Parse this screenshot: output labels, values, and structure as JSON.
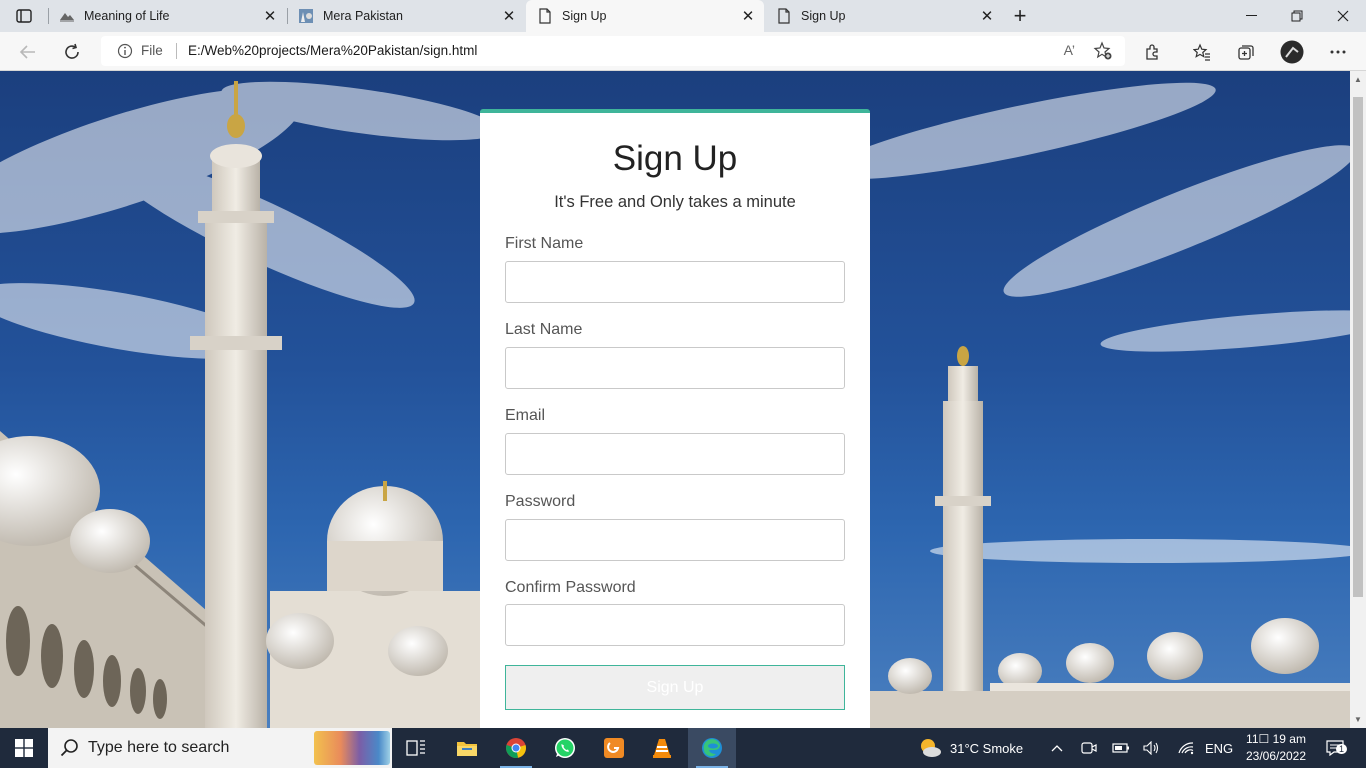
{
  "browser": {
    "tabs": [
      {
        "title": "Meaning of Life",
        "icon": "mountain-logo-icon"
      },
      {
        "title": "Mera Pakistan",
        "icon": "site-image-icon"
      },
      {
        "title": "Sign Up",
        "icon": "page-icon",
        "active": true
      },
      {
        "title": "Sign Up",
        "icon": "page-icon"
      }
    ],
    "address": {
      "file_label": "File",
      "url": "E:/Web%20projects/Mera%20Pakistan/sign.html",
      "read_aloud": "A’"
    }
  },
  "form": {
    "title": "Sign Up",
    "subtitle": "It's Free and Only takes a minute",
    "fields": [
      {
        "label": "First Name",
        "value": ""
      },
      {
        "label": "Last Name",
        "value": ""
      },
      {
        "label": "Email",
        "value": ""
      },
      {
        "label": "Password",
        "value": ""
      },
      {
        "label": "Confirm Password",
        "value": ""
      }
    ],
    "submit_label": "Sign Up",
    "accent_color": "#3fb59a"
  },
  "taskbar": {
    "search_placeholder": "Type here to search",
    "weather": "31°C  Smoke",
    "language": "ENG",
    "time": "11☐ 19 am",
    "date": "23/06/2022",
    "notification_count": "1"
  }
}
